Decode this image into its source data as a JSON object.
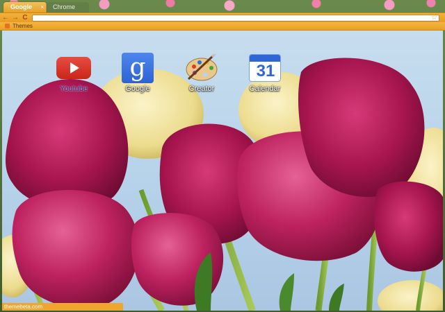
{
  "browser": {
    "tabs": [
      {
        "label": "Google",
        "close": "×"
      },
      {
        "label": "Chrome"
      }
    ],
    "nav": {
      "back": "←",
      "forward": "→",
      "reload": "C"
    },
    "omnibox": {
      "value": ""
    },
    "star": "☆"
  },
  "bookmarks": {
    "items": [
      {
        "label": "Themes"
      }
    ]
  },
  "apps": [
    {
      "label": "Youtube",
      "icon": "youtube-icon"
    },
    {
      "label": "Google",
      "icon": "google-icon",
      "glyph": "g"
    },
    {
      "label": "Creator",
      "icon": "palette-icon"
    },
    {
      "label": "Calendar",
      "icon": "calendar-icon",
      "glyph": "31"
    }
  ],
  "status": {
    "text": "themebeta.com"
  },
  "colors": {
    "accent": "#efa52e",
    "tab_text": "#ffffff",
    "label_text": "#ffffff"
  }
}
